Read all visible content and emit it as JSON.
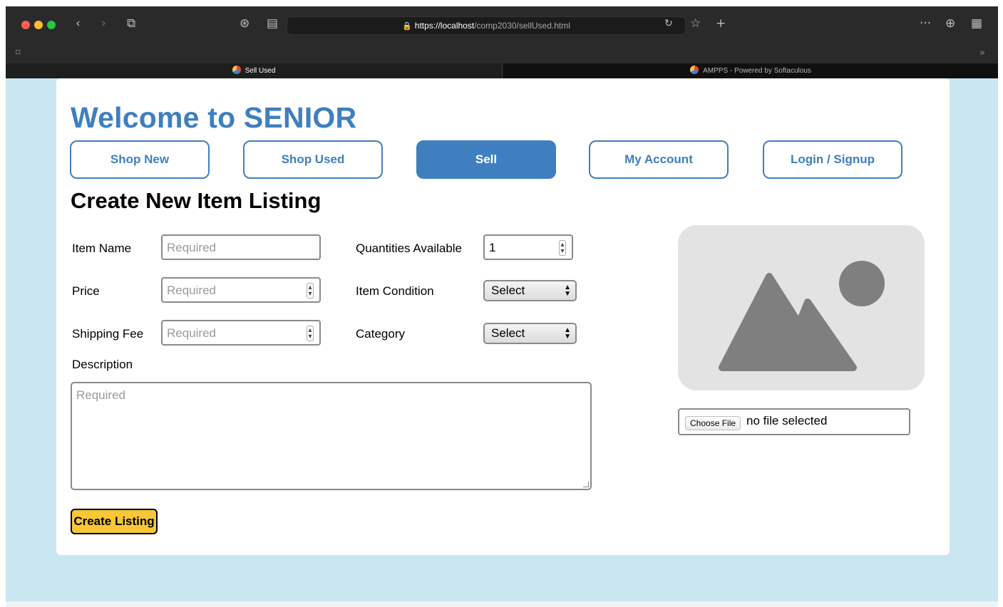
{
  "browser": {
    "url_host": "https://localhost",
    "url_path": "/comp2030/sellUsed.html",
    "tabs": [
      {
        "label": "Sell Used"
      },
      {
        "label": "AMPPS - Powered by Softaculous"
      }
    ],
    "icons": {
      "back": "‹",
      "forward": "›",
      "tabs": "⧉",
      "extension": "⊛",
      "reader": "▤",
      "lock": "🔒",
      "reload": "↻",
      "bookmark_star": "☆",
      "new_tab": "+",
      "more": "···",
      "download": "⊕",
      "grid": "▦",
      "bookmark": "⌑",
      "chevron_right": "»",
      "close": "×"
    }
  },
  "page": {
    "title": "Welcome to SENIOR",
    "nav": [
      {
        "label": "Shop New",
        "active": false
      },
      {
        "label": "Shop Used",
        "active": false
      },
      {
        "label": "Sell",
        "active": true
      },
      {
        "label": "My Account",
        "active": false
      },
      {
        "label": "Login / Signup",
        "active": false
      }
    ],
    "heading": "Create New Item Listing",
    "form": {
      "item_name": {
        "label": "Item Name",
        "placeholder": "Required"
      },
      "price": {
        "label": "Price",
        "placeholder": "Required"
      },
      "shipping_fee": {
        "label": "Shipping Fee",
        "placeholder": "Required"
      },
      "quantity": {
        "label": "Quantities Available",
        "value": "1"
      },
      "condition": {
        "label": "Item Condition",
        "value": "Select"
      },
      "category": {
        "label": "Category",
        "value": "Select"
      },
      "description": {
        "label": "Description",
        "placeholder": "Required"
      },
      "file": {
        "button": "Choose File",
        "status": "no file selected"
      },
      "submit_label": "Create Listing"
    },
    "colors": {
      "brand_blue": "#3f7fc0",
      "page_bg": "#c9e6f1",
      "submit_yellow": "#f8c736"
    }
  }
}
